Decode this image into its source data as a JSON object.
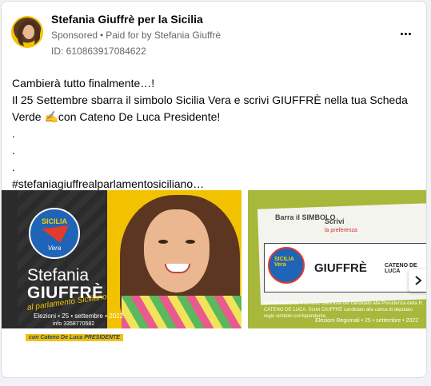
{
  "post": {
    "page_name": "Stefania Giuffrè per la Sicilia",
    "sponsored": "Sponsored",
    "separator": "•",
    "paid_for": "Paid for by Stefania Giuffrè",
    "ad_id": "ID: 610863917084622",
    "more_icon": "more-horizontal-icon"
  },
  "body": {
    "lines": [
      "Cambierà tutto finalmente…!",
      "Il 25 Settembre sbarra il simbolo Sicilia Vera e scrivi GIUFFRÈ nella tua Scheda",
      "Verde ✍️con Cateno De Luca Presidente!",
      ".",
      ".",
      ".",
      "#stefaniagiuffrealparlamentosiciliano…"
    ]
  },
  "carousel": {
    "slide1": {
      "logo_top": "SICILIA",
      "logo_mid": "Vera",
      "first_name": "Stefania",
      "last_name": "GIUFFRÈ",
      "tagline": "al parlamento Siciliano",
      "date": "Elezioni • 25 • settembre • 2022",
      "info": "info 3358770582",
      "president": "con Cateno De Luca PRESIDENTE"
    },
    "slide2": {
      "barra": "Barra il SIMBOLO",
      "scrivi": "Scrivi",
      "scrivi_sub": "la preferenza",
      "logo_text": "SICILIA Vera",
      "name": "GIUFFRÈ",
      "cateno": "CATENO DE LUCA",
      "footer": "Si vota barrando il simbolo della lista del candidato alla Presidenza della R. CATENO DE LUCA. Scrivi GIUFFRÈ candidato alla carica di deputato regio simbolo corrispondente.",
      "election": "Elezioni Regionali • 25 • settembre • 2022"
    },
    "next_icon": "chevron-right-icon"
  }
}
